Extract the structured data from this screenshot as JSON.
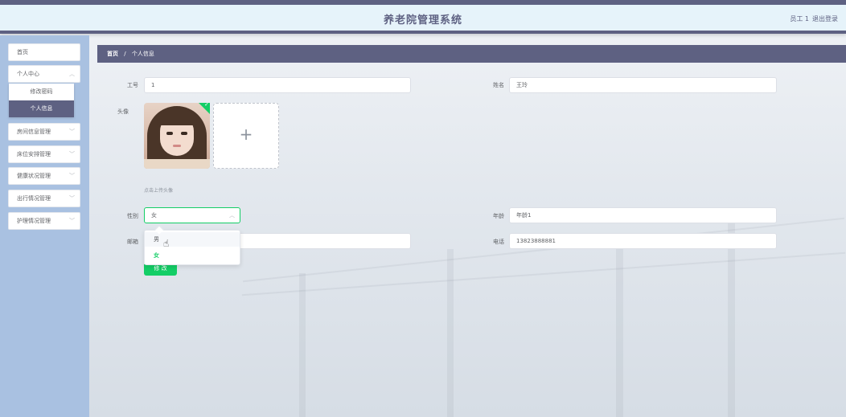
{
  "header": {
    "title": "养老院管理系统",
    "user": "员工 1",
    "logout": "退出登录"
  },
  "sidebar": {
    "items": [
      {
        "label": "首页"
      },
      {
        "label": "个人中心"
      },
      {
        "label": "房间信息管理"
      },
      {
        "label": "床位安排管理"
      },
      {
        "label": "健康状况管理"
      },
      {
        "label": "出行情况管理"
      },
      {
        "label": "护理情况管理"
      }
    ],
    "submenu": [
      {
        "label": "修改密码"
      },
      {
        "label": "个人信息",
        "active": true
      }
    ]
  },
  "breadcrumb": {
    "home": "首页",
    "separator": "/",
    "current": "个人信息"
  },
  "form": {
    "employee_no": {
      "label": "工号",
      "value": "1"
    },
    "name": {
      "label": "姓名",
      "value": "王玲"
    },
    "avatar": {
      "label": "头像",
      "hint": "点击上传头像"
    },
    "gender": {
      "label": "性别",
      "value": "女",
      "options": [
        "男",
        "女"
      ]
    },
    "age": {
      "label": "年龄",
      "value": "年龄1"
    },
    "email": {
      "label": "邮箱",
      "value": ""
    },
    "phone": {
      "label": "电话",
      "value": "13823888881"
    },
    "submit_label": "修 改"
  },
  "colors": {
    "accent": "#5e6182",
    "success": "#13ce66",
    "sidebar_bg": "#a9c1e1"
  },
  "icons": {
    "upload": "plus-icon",
    "check": "check-icon",
    "chevron": "chevron-down-icon",
    "cursor": "hand-pointer-icon"
  }
}
